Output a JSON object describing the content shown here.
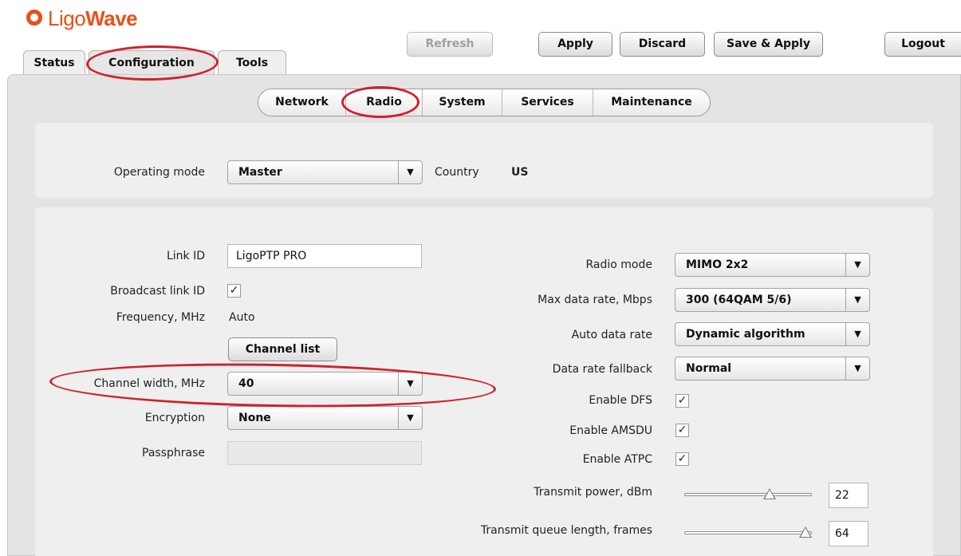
{
  "logo": {
    "part1": "Ligo",
    "part2": "Wave"
  },
  "top_tabs": [
    "Status",
    "Configuration",
    "Tools"
  ],
  "toolbar": {
    "refresh": "Refresh",
    "apply": "Apply",
    "discard": "Discard",
    "save_apply": "Save & Apply",
    "logout": "Logout"
  },
  "subnav": [
    "Network",
    "Radio",
    "System",
    "Services",
    "Maintenance"
  ],
  "general": {
    "operating_mode_label": "Operating mode",
    "operating_mode_value": "Master",
    "country_label": "Country",
    "country_value": "US"
  },
  "left": {
    "link_id_label": "Link ID",
    "link_id_value": "LigoPTP PRO",
    "broadcast_label": "Broadcast link ID",
    "frequency_label": "Frequency, MHz",
    "frequency_value": "Auto",
    "channel_list_button": "Channel list",
    "channel_width_label": "Channel width, MHz",
    "channel_width_value": "40",
    "encryption_label": "Encryption",
    "encryption_value": "None",
    "passphrase_label": "Passphrase",
    "passphrase_value": ""
  },
  "right": {
    "radio_mode_label": "Radio mode",
    "radio_mode_value": "MIMO 2x2",
    "max_rate_label": "Max data rate, Mbps",
    "max_rate_value": "300 (64QAM 5/6)",
    "auto_rate_label": "Auto data rate",
    "auto_rate_value": "Dynamic algorithm",
    "fallback_label": "Data rate fallback",
    "fallback_value": "Normal",
    "dfs_label": "Enable DFS",
    "amsdu_label": "Enable AMSDU",
    "atpc_label": "Enable ATPC",
    "tx_power_label": "Transmit power, dBm",
    "tx_power_value": "22",
    "tx_queue_label": "Transmit queue length, frames",
    "tx_queue_value": "64"
  },
  "checkmark": "✓",
  "select_arrow": "▼",
  "colors": {
    "logo": "#e8501a",
    "annotation": "#d0212b",
    "panel": "#efefef",
    "background": "#e4e4e4"
  },
  "slider_levels": {
    "tx_power_fraction": 0.72,
    "tx_queue_fraction": 1.0
  }
}
